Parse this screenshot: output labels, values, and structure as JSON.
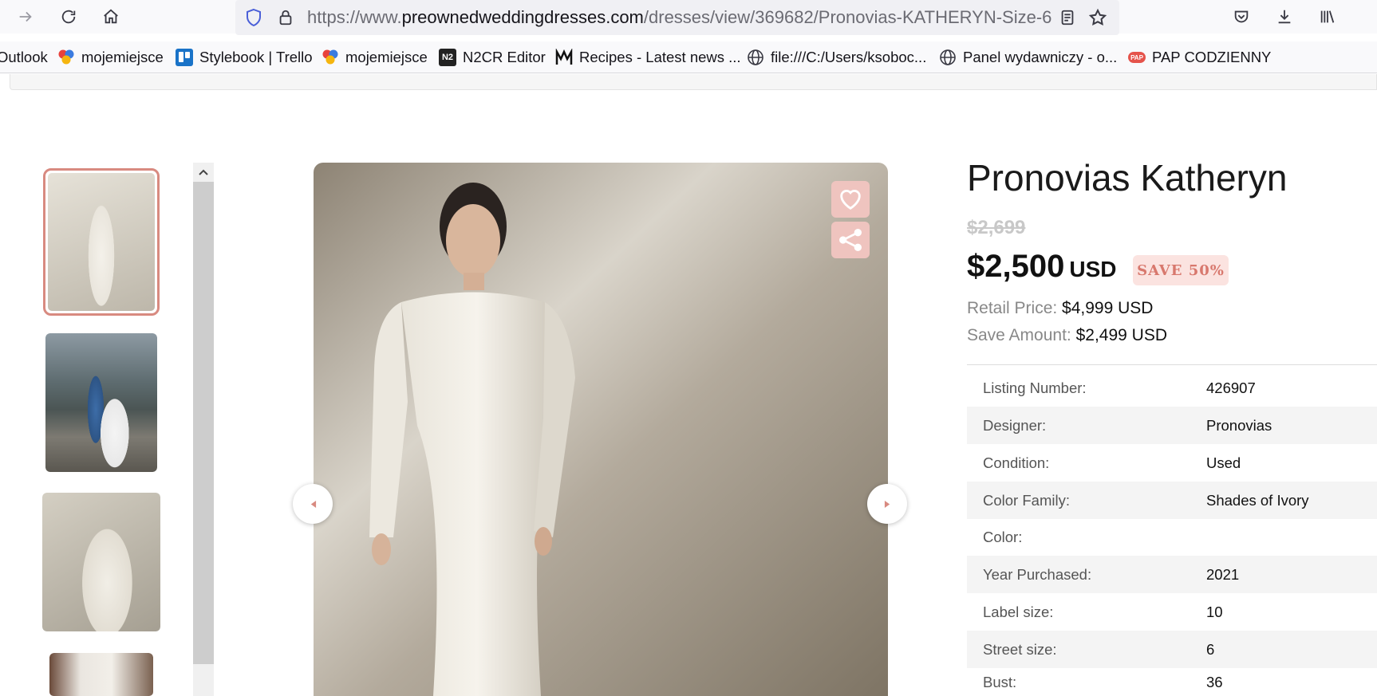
{
  "browser": {
    "url_prefix": "https://www.",
    "url_domain": "preownedweddingdresses.com",
    "url_path": "/dresses/view/369682/Pronovias-KATHERYN-Size-6"
  },
  "bookmarks": [
    {
      "label": "Outlook",
      "icon": "outlook-icon"
    },
    {
      "label": "mojemiejsce",
      "icon": "mojemiejsce-icon"
    },
    {
      "label": "Stylebook | Trello",
      "icon": "trello-icon"
    },
    {
      "label": "mojemiejsce",
      "icon": "mojemiejsce-icon"
    },
    {
      "label": "N2CR Editor",
      "icon": "n2-icon"
    },
    {
      "label": "Recipes - Latest news ...",
      "icon": "recipes-icon"
    },
    {
      "label": "file:///C:/Users/ksoboc...",
      "icon": "globe-icon"
    },
    {
      "label": "Panel wydawniczy - o...",
      "icon": "globe-icon"
    },
    {
      "label": "PAP CODZIENNY",
      "icon": "pap-icon"
    }
  ],
  "n2_badge": "N2",
  "pap_badge": "PAP",
  "product": {
    "title": "Pronovias Katheryn",
    "old_price": "$2,699",
    "price": "$2,500",
    "currency": "USD",
    "save_badge": "SAVE 50%",
    "retail_label": "Retail Price:",
    "retail_value": "$4,999 USD",
    "save_label": "Save Amount:",
    "save_value": "$2,499 USD"
  },
  "specs": [
    {
      "label": "Listing Number:",
      "value": "426907"
    },
    {
      "label": "Designer:",
      "value": "Pronovias"
    },
    {
      "label": "Condition:",
      "value": "Used"
    },
    {
      "label": "Color Family:",
      "value": "Shades of Ivory"
    },
    {
      "label": "Color:",
      "value": ""
    },
    {
      "label": "Year Purchased:",
      "value": "2021"
    },
    {
      "label": "Label size:",
      "value": "10"
    },
    {
      "label": "Street size:",
      "value": "6"
    },
    {
      "label": "Bust:",
      "value": "36"
    }
  ],
  "colors": {
    "accent": "#d88a80",
    "badge_bg": "#fbe3e0",
    "photo_btn": "#efc4bf"
  }
}
